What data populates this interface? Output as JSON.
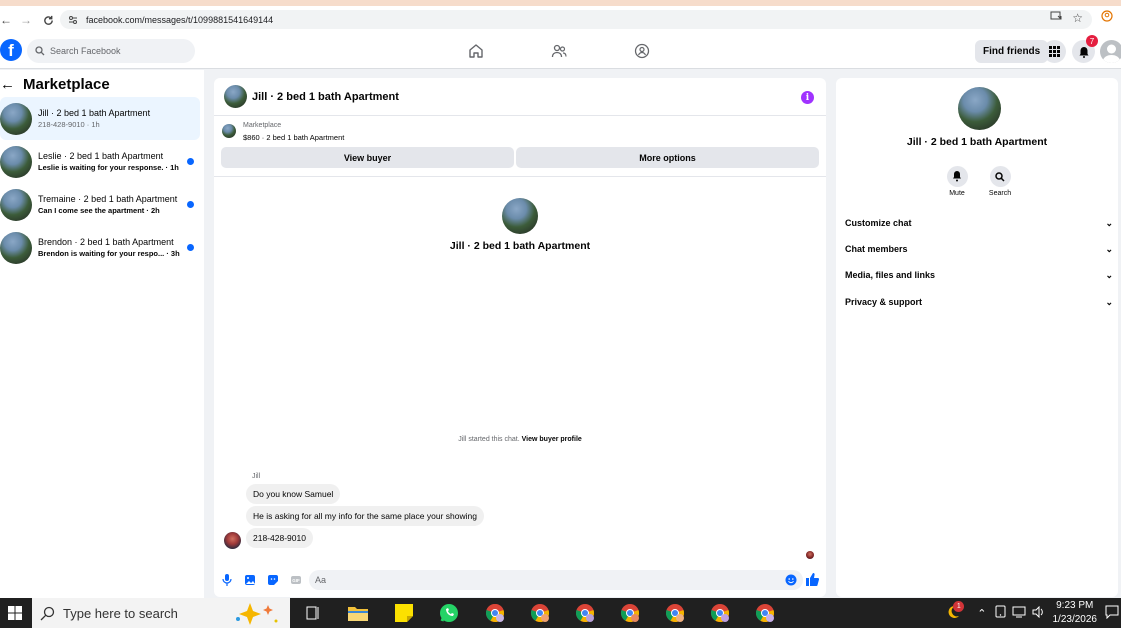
{
  "browser": {
    "url": "facebook.com/messages/t/1099881541649144"
  },
  "fb": {
    "search_placeholder": "Search Facebook",
    "find_friends": "Find friends",
    "notif_count": "7"
  },
  "sidebar": {
    "title": "Marketplace",
    "conversations": [
      {
        "name": "Jill · 2 bed 1 bath Apartment",
        "sub": "218-428-9010 · 1h",
        "active": true,
        "unread": false
      },
      {
        "name": "Leslie · 2 bed 1 bath Apartment",
        "sub": "Leslie is waiting for your response. · 1h",
        "active": false,
        "unread": true
      },
      {
        "name": "Tremaine · 2 bed 1 bath Apartment",
        "sub": "Can I come see the apartment · 2h",
        "active": false,
        "unread": true
      },
      {
        "name": "Brendon · 2 bed 1 bath Apartment",
        "sub": "Brendon is waiting for your respo... · 3h",
        "active": false,
        "unread": true
      }
    ]
  },
  "chat": {
    "title": "Jill · 2 bed 1 bath Apartment",
    "listing_label": "Marketplace",
    "listing_price": "$860 · 2 bed 1 bath Apartment",
    "view_buyer": "View buyer",
    "more_options": "More options",
    "center_name": "Jill · 2 bed 1 bath Apartment",
    "started_text": "Jill started this chat.",
    "started_link": "View buyer profile",
    "sender": "Jill",
    "messages": [
      "Do you know Samuel",
      "He is asking for all my info for the same place your showing",
      "218-428-9010"
    ],
    "composer_placeholder": "Aa"
  },
  "details": {
    "name": "Jill · 2 bed 1 bath Apartment",
    "mute": "Mute",
    "search": "Search",
    "sections": [
      "Customize chat",
      "Chat members",
      "Media, files and links",
      "Privacy & support"
    ]
  },
  "taskbar": {
    "search_placeholder": "Type here to search",
    "tray_badge": "1",
    "time": "9:23 PM",
    "date": "1/23/2026"
  },
  "colors": {
    "fb_blue": "#0866ff",
    "info_purple": "#a033ff",
    "unread_blue": "#0866ff",
    "active_row": "#ebf5ff"
  }
}
